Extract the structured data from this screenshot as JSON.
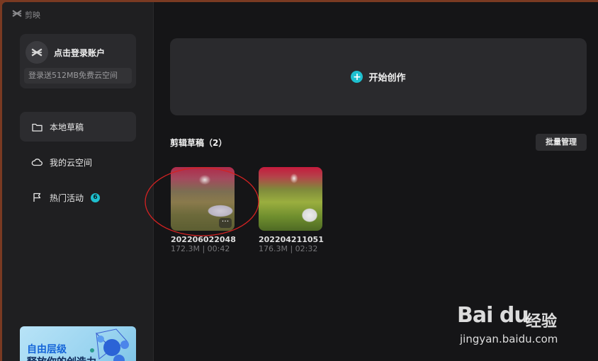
{
  "app": {
    "name": "剪映"
  },
  "account": {
    "login_label": "点击登录账户",
    "promo": "登录送512MB免费云空间"
  },
  "sidebar": {
    "items": [
      {
        "label": "本地草稿",
        "icon": "folder-icon"
      },
      {
        "label": "我的云空间",
        "icon": "cloud-icon"
      },
      {
        "label": "热门活动",
        "icon": "flag-icon",
        "badge": "6"
      }
    ]
  },
  "topbar": {
    "icons": [
      "help-icon",
      "feedback-icon",
      "settings-icon",
      "minimize-icon",
      "close-icon"
    ]
  },
  "create": {
    "label": "开始创作"
  },
  "drafts": {
    "title": "剪辑草稿（2）",
    "batch_label": "批量管理",
    "items": [
      {
        "name": "202206022048",
        "meta": "172.3M | 00:42"
      },
      {
        "name": "202204211051",
        "meta": "176.3M | 02:32"
      }
    ]
  },
  "banner": {
    "line1": "自由层级",
    "line2": "释放你的创造力"
  },
  "watermark": {
    "logo": "Bai du",
    "text": "经验",
    "url": "jingyan.baidu.com"
  },
  "colors": {
    "accent": "#1ec0cf",
    "annotation": "#d42222"
  }
}
